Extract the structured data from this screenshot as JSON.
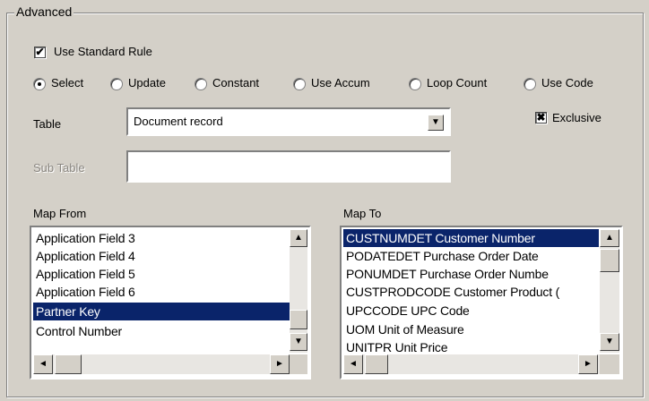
{
  "group": {
    "title": "Advanced"
  },
  "use_standard_rule": {
    "label": "Use Standard Rule",
    "checked": true
  },
  "radios": [
    {
      "label": "Select",
      "selected": true
    },
    {
      "label": "Update",
      "selected": false
    },
    {
      "label": "Constant",
      "selected": false
    },
    {
      "label": "Use Accum",
      "selected": false
    },
    {
      "label": "Loop Count",
      "selected": false
    },
    {
      "label": "Use Code",
      "selected": false
    }
  ],
  "table": {
    "label": "Table",
    "value": "Document record"
  },
  "exclusive": {
    "label": "Exclusive",
    "checked": true
  },
  "sub_table": {
    "label": "Sub Table",
    "value": ""
  },
  "map_from": {
    "label": "Map From",
    "items": [
      "Application Field 3",
      "Application Field 4",
      "Application Field 5",
      "Application Field 6",
      "Partner Key",
      "Control Number"
    ],
    "selected_index": 4
  },
  "map_to": {
    "label": "Map To",
    "items": [
      "CUSTNUMDET Customer Number",
      "PODATEDET Purchase Order Date",
      "PONUMDET Purchase Order Numbe",
      "CUSTPRODCODE Customer Product (",
      "UPCCODE UPC Code",
      "UOM Unit of Measure",
      "UNITPR Unit Price"
    ],
    "selected_index": 0
  },
  "icons": {
    "checkmark": "✔",
    "xmark": "✖",
    "arrow_up": "▲",
    "arrow_down": "▼",
    "arrow_left": "◄",
    "arrow_right": "►"
  }
}
